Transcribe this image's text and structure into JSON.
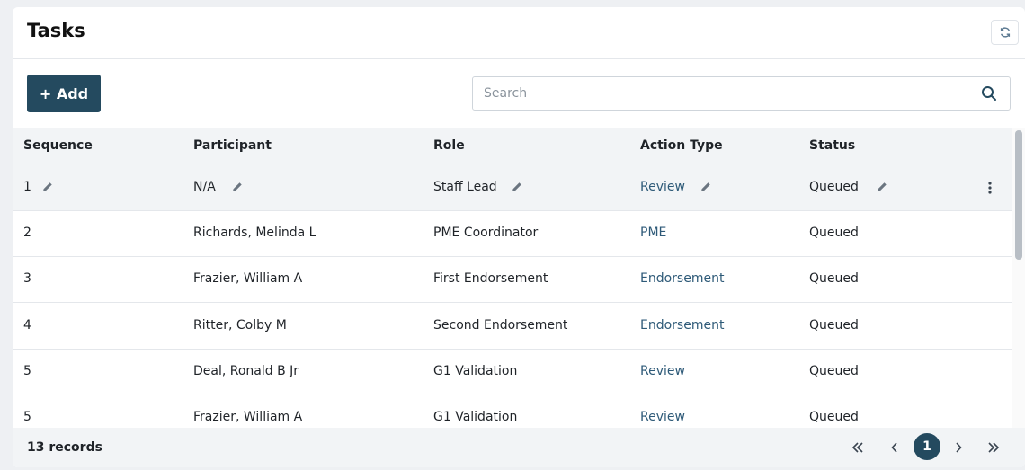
{
  "header": {
    "title": "Tasks",
    "refresh_icon": "refresh-icon"
  },
  "toolbar": {
    "add_label": "+ Add",
    "search_placeholder": "Search",
    "search_value": ""
  },
  "table": {
    "columns": [
      "Sequence",
      "Participant",
      "Role",
      "Action Type",
      "Status"
    ],
    "rows": [
      {
        "sequence": "1",
        "participant": "N/A",
        "role": "Staff Lead",
        "action_type": "Review",
        "status": "Queued"
      },
      {
        "sequence": "2",
        "participant": "Richards, Melinda L",
        "role": "PME Coordinator",
        "action_type": "PME",
        "status": "Queued"
      },
      {
        "sequence": "3",
        "participant": "Frazier, William A",
        "role": "First Endorsement",
        "action_type": "Endorsement",
        "status": "Queued"
      },
      {
        "sequence": "4",
        "participant": "Ritter, Colby M",
        "role": "Second Endorsement",
        "action_type": "Endorsement",
        "status": "Queued"
      },
      {
        "sequence": "5",
        "participant": "Deal, Ronald B Jr",
        "role": "G1 Validation",
        "action_type": "Review",
        "status": "Queued"
      },
      {
        "sequence": "5",
        "participant": "Frazier, William A",
        "role": "G1 Validation",
        "action_type": "Review",
        "status": "Queued"
      }
    ]
  },
  "footer": {
    "records": "13 records",
    "current_page": "1"
  },
  "colors": {
    "primary": "#244a5f",
    "link": "#2e5a78",
    "header_bg": "#f2f4f6"
  }
}
